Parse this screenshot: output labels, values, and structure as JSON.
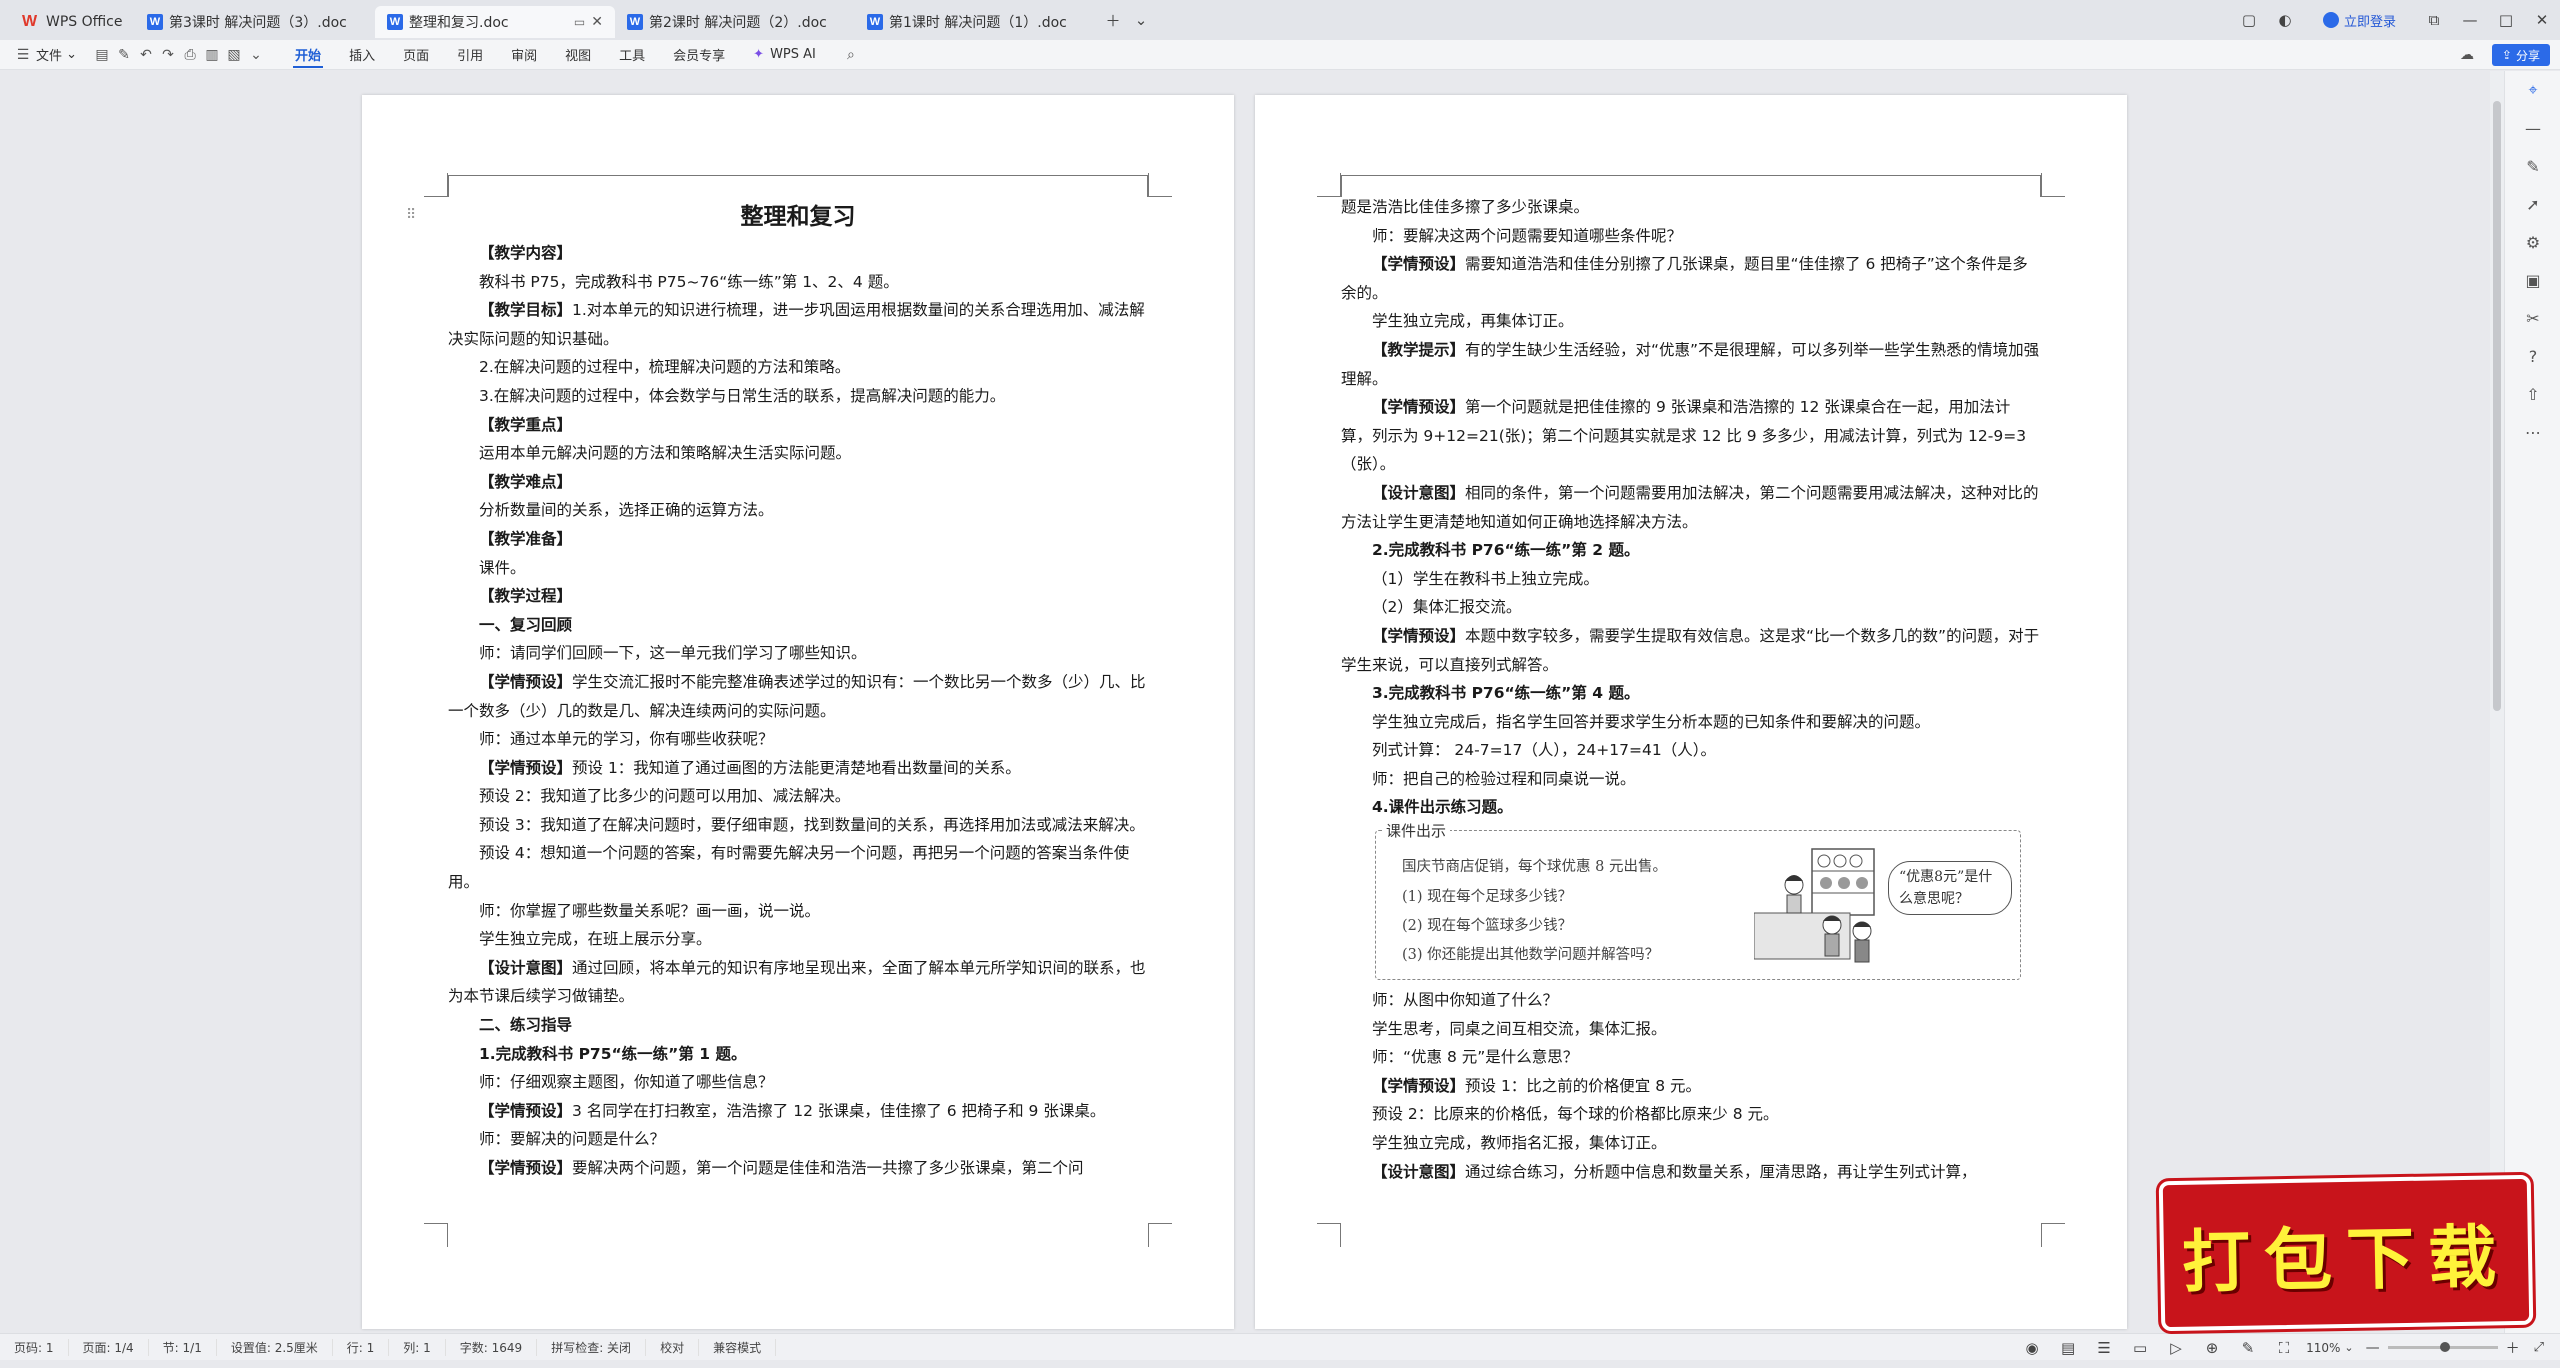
{
  "tabs": [
    {
      "label": "WPS Office",
      "kind": "wps"
    },
    {
      "label": "第3课时  解决问题（3）.doc",
      "kind": "doc"
    },
    {
      "label": "整理和复习.doc",
      "kind": "doc",
      "active": true
    },
    {
      "label": "第2课时  解决问题（2）.doc",
      "kind": "doc"
    },
    {
      "label": "第1课时  解决问题（1）.doc",
      "kind": "doc"
    }
  ],
  "titlebar": {
    "login": "立即登录"
  },
  "ribbon": {
    "file": "文件",
    "tabs": [
      "开始",
      "插入",
      "页面",
      "引用",
      "审阅",
      "视图",
      "工具",
      "会员专享"
    ],
    "ai": "WPS AI",
    "share": "分享"
  },
  "page1": {
    "title": "整理和复习",
    "paragraphs": [
      {
        "t": "【教学内容】",
        "c": "in b"
      },
      {
        "t": "教科书 P75，完成教科书 P75~76“练一练”第 1、2、4 题。",
        "c": "in"
      },
      {
        "t": "【教学目标】1.对本单元的知识进行梳理，进一步巩固运用根据数量间的关系合理选用加、减法解决实际问题的知识基础。",
        "c": "in",
        "bold": "【教学目标】"
      },
      {
        "t": "2.在解决问题的过程中，梳理解决问题的方法和策略。",
        "c": "in"
      },
      {
        "t": "3.在解决问题的过程中，体会数学与日常生活的联系，提高解决问题的能力。",
        "c": "in"
      },
      {
        "t": "【教学重点】",
        "c": "in b"
      },
      {
        "t": "运用本单元解决问题的方法和策略解决生活实际问题。",
        "c": "in"
      },
      {
        "t": "【教学难点】",
        "c": "in b"
      },
      {
        "t": "分析数量间的关系，选择正确的运算方法。",
        "c": "in"
      },
      {
        "t": "【教学准备】",
        "c": "in b"
      },
      {
        "t": "课件。",
        "c": "in"
      },
      {
        "t": "【教学过程】",
        "c": "in b"
      },
      {
        "t": "一、复习回顾",
        "c": "in b"
      },
      {
        "t": "师：请同学们回顾一下，这一单元我们学习了哪些知识。",
        "c": "in"
      },
      {
        "t": "【学情预设】学生交流汇报时不能完整准确表述学过的知识有：一个数比另一个数多（少）几、比一个数多（少）几的数是几、解决连续两问的实际问题。",
        "c": "in",
        "bold": "【学情预设】"
      },
      {
        "t": "师：通过本单元的学习，你有哪些收获呢？",
        "c": "in"
      },
      {
        "t": "【学情预设】预设 1：我知道了通过画图的方法能更清楚地看出数量间的关系。",
        "c": "in",
        "bold": "【学情预设】"
      },
      {
        "t": "预设 2：我知道了比多少的问题可以用加、减法解决。",
        "c": "in"
      },
      {
        "t": "预设 3：我知道了在解决问题时，要仔细审题，找到数量间的关系，再选择用加法或减法来解决。",
        "c": "in"
      },
      {
        "t": "预设 4：想知道一个问题的答案，有时需要先解决另一个问题，再把另一个问题的答案当条件使用。",
        "c": "in"
      },
      {
        "t": "师：你掌握了哪些数量关系呢？画一画，说一说。",
        "c": "in"
      },
      {
        "t": "学生独立完成，在班上展示分享。",
        "c": "in"
      },
      {
        "t": "【设计意图】通过回顾，将本单元的知识有序地呈现出来，全面了解本单元所学知识间的联系，也为本节课后续学习做铺垫。",
        "c": "in",
        "bold": "【设计意图】"
      },
      {
        "t": "二、练习指导",
        "c": "in b"
      },
      {
        "t": "1.完成教科书 P75“练一练”第 1 题。",
        "c": "in b"
      },
      {
        "t": "师：仔细观察主题图，你知道了哪些信息？",
        "c": "in"
      },
      {
        "t": "【学情预设】3 名同学在打扫教室，浩浩擦了 12 张课桌，佳佳擦了 6 把椅子和 9 张课桌。",
        "c": "in",
        "bold": "【学情预设】"
      },
      {
        "t": "师：要解决的问题是什么？",
        "c": "in"
      },
      {
        "t": "【学情预设】要解决两个问题，第一个问题是佳佳和浩浩一共擦了多少张课桌，第二个问",
        "c": "in",
        "bold": "【学情预设】"
      }
    ]
  },
  "page2": {
    "paragraphs_top": [
      {
        "t": "题是浩浩比佳佳多擦了多少张课桌。",
        "c": ""
      },
      {
        "t": "师：要解决这两个问题需要知道哪些条件呢？",
        "c": "in"
      },
      {
        "t": "【学情预设】需要知道浩浩和佳佳分别擦了几张课桌，题目里“佳佳擦了 6 把椅子”这个条件是多余的。",
        "c": "in",
        "bold": "【学情预设】"
      },
      {
        "t": "学生独立完成，再集体订正。",
        "c": "in"
      },
      {
        "t": "【教学提示】有的学生缺少生活经验，对“优惠”不是很理解，可以多列举一些学生熟悉的情境加强理解。",
        "c": "in",
        "bold": "【教学提示】"
      },
      {
        "t": "【学情预设】第一个问题就是把佳佳擦的 9 张课桌和浩浩擦的 12 张课桌合在一起，用加法计算，列示为 9+12=21(张)；第二个问题其实就是求 12 比 9 多多少，用减法计算，列式为 12-9=3（张）。",
        "c": "in",
        "bold": "【学情预设】"
      },
      {
        "t": "【设计意图】相同的条件，第一个问题需要用加法解决，第二个问题需要用减法解决，这种对比的方法让学生更清楚地知道如何正确地选择解决方法。",
        "c": "in",
        "bold": "【设计意图】"
      },
      {
        "t": "2.完成教科书 P76“练一练”第 2 题。",
        "c": "in b"
      },
      {
        "t": "（1）学生在教科书上独立完成。",
        "c": "in"
      },
      {
        "t": "（2）集体汇报交流。",
        "c": "in"
      },
      {
        "t": "【学情预设】本题中数字较多，需要学生提取有效信息。这是求“比一个数多几的数”的问题，对于学生来说，可以直接列式解答。",
        "c": "in",
        "bold": "【学情预设】"
      },
      {
        "t": "3.完成教科书 P76“练一练”第 4 题。",
        "c": "in b"
      },
      {
        "t": "学生独立完成后，指名学生回答并要求学生分析本题的已知条件和要解决的问题。",
        "c": "in"
      },
      {
        "t": "列式计算：  24-7=17（人），24+17=41（人）。",
        "c": "in"
      },
      {
        "t": "师：把自己的检验过程和同桌说一说。",
        "c": "in"
      },
      {
        "t": "4.课件出示练习题。",
        "c": "in b"
      }
    ],
    "figure": {
      "caption": "课件出示",
      "lines": [
        "国庆节商店促销，每个球优惠 8 元出售。",
        "(1) 现在每个足球多少钱？",
        "(2) 现在每个篮球多少钱？",
        "(3) 你还能提出其他数学问题并解答吗？"
      ],
      "bubble": "“优惠8元”是什么意思呢？"
    },
    "paragraphs_bottom": [
      {
        "t": "师：从图中你知道了什么？",
        "c": "in"
      },
      {
        "t": "学生思考，同桌之间互相交流，集体汇报。",
        "c": "in"
      },
      {
        "t": "师：“优惠 8 元”是什么意思？",
        "c": "in"
      },
      {
        "t": "【学情预设】预设 1：比之前的价格便宜 8 元。",
        "c": "in",
        "bold": "【学情预设】"
      },
      {
        "t": "预设 2：比原来的价格低，每个球的价格都比原来少 8 元。",
        "c": "in"
      },
      {
        "t": "学生独立完成，教师指名汇报，集体订正。",
        "c": "in"
      },
      {
        "t": "【设计意图】通过综合练习，分析题中信息和数量关系，厘清思路，再让学生列式计算，",
        "c": "in",
        "bold": "【设计意图】"
      }
    ]
  },
  "status": {
    "items": [
      "页码: 1",
      "页面: 1/4",
      "节: 1/1",
      "设置值: 2.5厘米",
      "行: 1",
      "列: 1",
      "字数: 1649",
      "拼写检查: 关闭",
      "校对",
      "兼容模式"
    ],
    "zoom": "110%"
  },
  "promo": {
    "label": "打包下载"
  },
  "colors": {
    "accent": "#2b6ae8",
    "promo_bg": "#c8141b",
    "promo_text": "#fff23a"
  }
}
